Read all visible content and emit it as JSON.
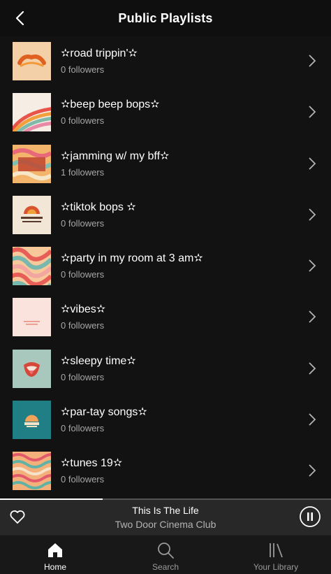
{
  "header": {
    "title": "Public Playlists",
    "back_icon": "chevron-left-icon"
  },
  "playlists": [
    {
      "title": "✫road trippin'✫",
      "followers": "0 followers",
      "cover": "groovy"
    },
    {
      "title": "✫beep beep bops✫",
      "followers": "0 followers",
      "cover": "rainbow"
    },
    {
      "title": "✫jamming w/ my bff✫",
      "followers": "1 followers",
      "cover": "go-crazy"
    },
    {
      "title": "✫tiktok bops ✫",
      "followers": "0 followers",
      "cover": "radiate-positivity"
    },
    {
      "title": "✫party in my room at 3 am✫",
      "followers": "0 followers",
      "cover": "waves"
    },
    {
      "title": "✫vibes✫",
      "followers": "0 followers",
      "cover": "pink-text"
    },
    {
      "title": "✫sleepy time✫",
      "followers": "0 followers",
      "cover": "lips"
    },
    {
      "title": "✫par-tay songs✫",
      "followers": "0 followers",
      "cover": "teal-logo"
    },
    {
      "title": "✫tunes 19✫",
      "followers": "0 followers",
      "cover": "pattern"
    }
  ],
  "player": {
    "track_title": "This Is The Life",
    "artist": "Two Door Cinema Club",
    "progress_fraction": 0.31,
    "like_icon": "heart-icon",
    "control_icon": "pause-icon"
  },
  "tabs": [
    {
      "label": "Home",
      "icon": "home-icon",
      "active": true
    },
    {
      "label": "Search",
      "icon": "search-icon",
      "active": false
    },
    {
      "label": "Your Library",
      "icon": "library-icon",
      "active": false
    }
  ],
  "colors": {
    "background": "#121212",
    "player_bg": "#282828",
    "tabbar_bg": "#181818",
    "muted_text": "#a7a7a7"
  }
}
